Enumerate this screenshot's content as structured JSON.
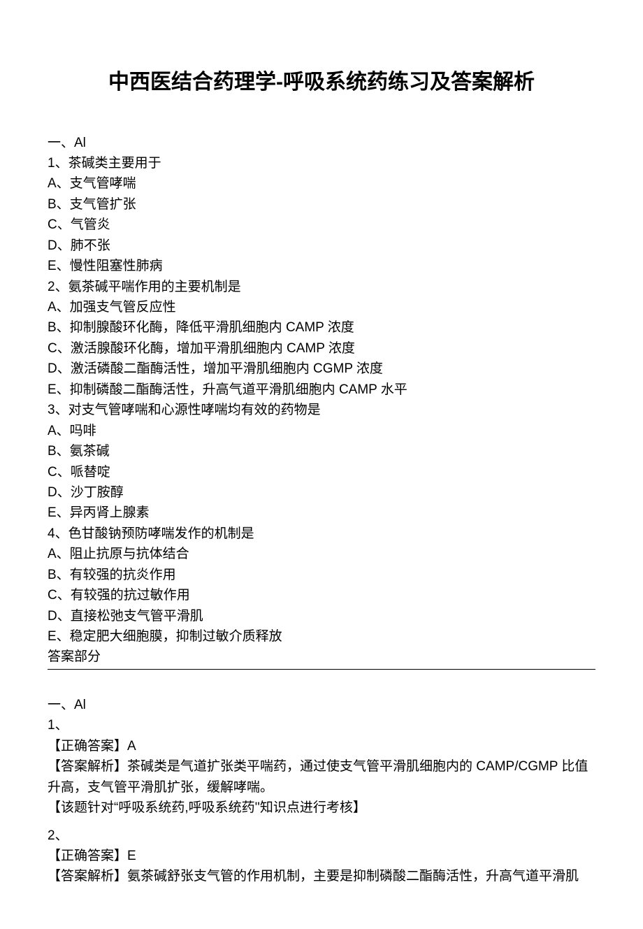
{
  "title": "中西医结合药理学-呼吸系统药练习及答案解析",
  "section1_header": "一、Al",
  "questions": [
    {
      "num": "1、",
      "stem": "茶碱类主要用于",
      "opts": [
        "A、支气管哮喘",
        "B、支气管扩张",
        "C、气管炎",
        "D、肺不张",
        "E、慢性阻塞性肺病"
      ]
    },
    {
      "num": "2、",
      "stem": "氨茶碱平喘作用的主要机制是",
      "opts": [
        "A、加强支气管反应性",
        "B、抑制腺酸环化酶，降低平滑肌细胞内 CAMP 浓度",
        "C、激活腺酸环化酶，增加平滑肌细胞内 CAMP 浓度",
        "D、激活磷酸二酯酶活性，增加平滑肌细胞内 CGMP 浓度",
        "E、抑制磷酸二酯酶活性，升高气道平滑肌细胞内 CAMP 水平"
      ]
    },
    {
      "num": "3、",
      "stem": "对支气管哮喘和心源性哮喘均有效的药物是",
      "opts": [
        "A、吗啡",
        "B、氨茶碱",
        "C、哌替啶",
        "D、沙丁胺醇",
        "E、异丙肾上腺素"
      ]
    },
    {
      "num": "4、",
      "stem": "色甘酸钠预防哮喘发作的机制是",
      "opts": [
        "A、阻止抗原与抗体结合",
        "B、有较强的抗炎作用",
        "C、有较强的抗过敏作用",
        "D、直接松弛支气管平滑肌",
        "E、稳定肥大细胞膜，抑制过敏介质释放"
      ]
    }
  ],
  "answers_label": "答案部分",
  "section2_header": "一、Al",
  "answers": [
    {
      "num": "1、",
      "correct_label": "【正确答案】",
      "correct": "A",
      "explain_label": "【答案解析】",
      "explain": "茶碱类是气道扩张类平喘药，通过使支气管平滑肌细胞内的 CAMP/CGMP 比值升高，支气管平滑肌扩张，缓解哮喘。",
      "point": "【该题针对“呼吸系统药,呼吸系统药''知识点进行考核】"
    },
    {
      "num": "2、",
      "correct_label": "【正确答案】",
      "correct": "E",
      "explain_label": "【答案解析】",
      "explain": "氨茶碱舒张支气管的作用机制，主要是抑制磷酸二酯酶活性，升高气道平滑肌"
    }
  ]
}
